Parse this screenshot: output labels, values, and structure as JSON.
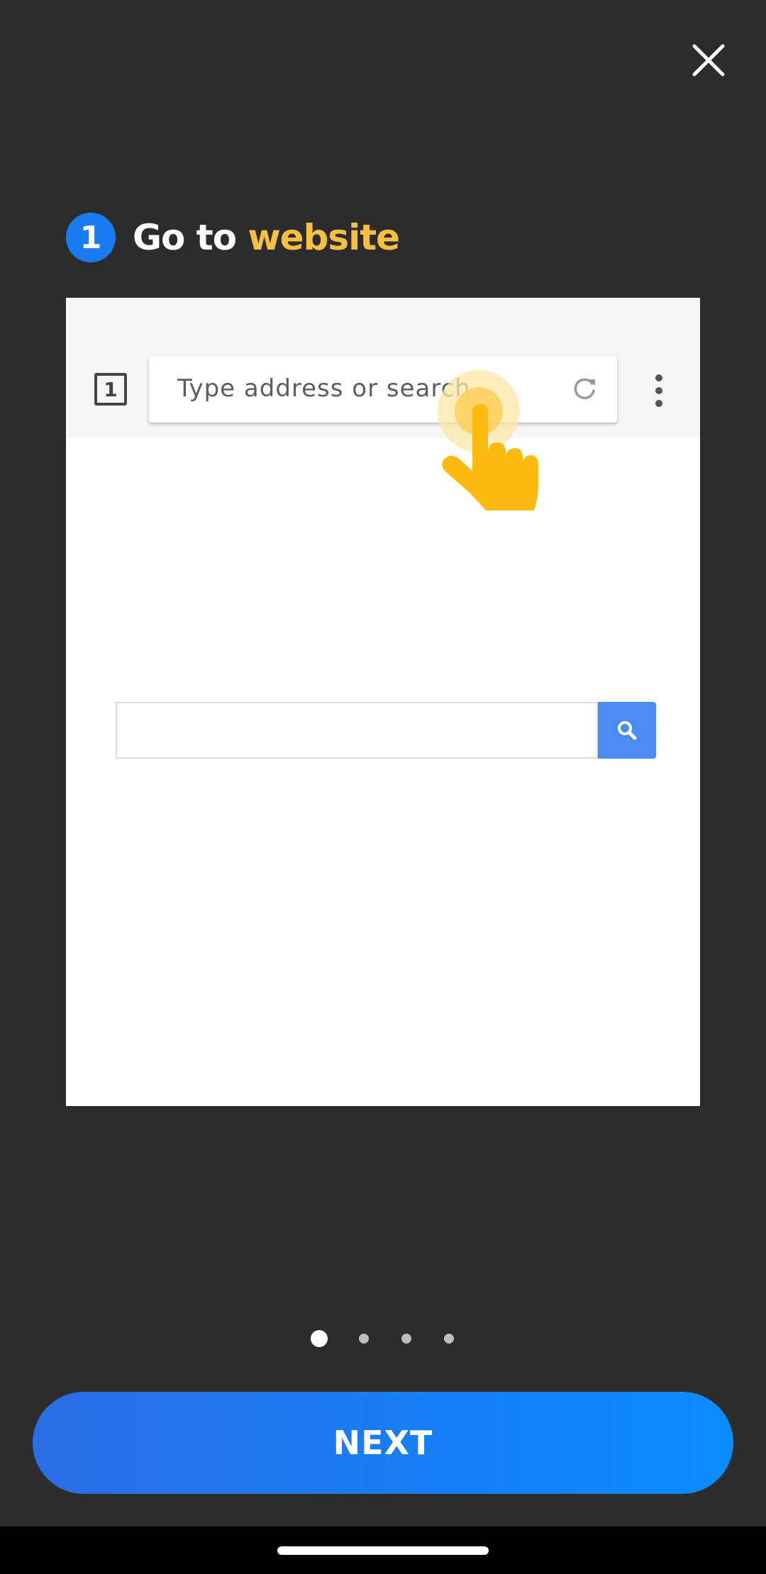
{
  "step": {
    "number": "1",
    "title_prefix": "Go to",
    "title_accent": "website"
  },
  "illustration": {
    "tab_count": "1",
    "address_placeholder": "Type address or search"
  },
  "pagination": {
    "total": 4,
    "current": 1
  },
  "buttons": {
    "next_label": "NEXT"
  },
  "colors": {
    "background": "#2c2c2c",
    "step_badge": "#1a7cf2",
    "title_accent": "#f7c043",
    "next_button_start": "#2b6de6",
    "next_button_end": "#0a8cff",
    "search_button": "#4a8cf3",
    "tap_hand": "#fdbb12"
  },
  "icons": {
    "close": "close-icon",
    "reload": "reload-icon",
    "menu": "more-vert-icon",
    "search": "search-icon",
    "tap": "hand-pointer-icon"
  }
}
